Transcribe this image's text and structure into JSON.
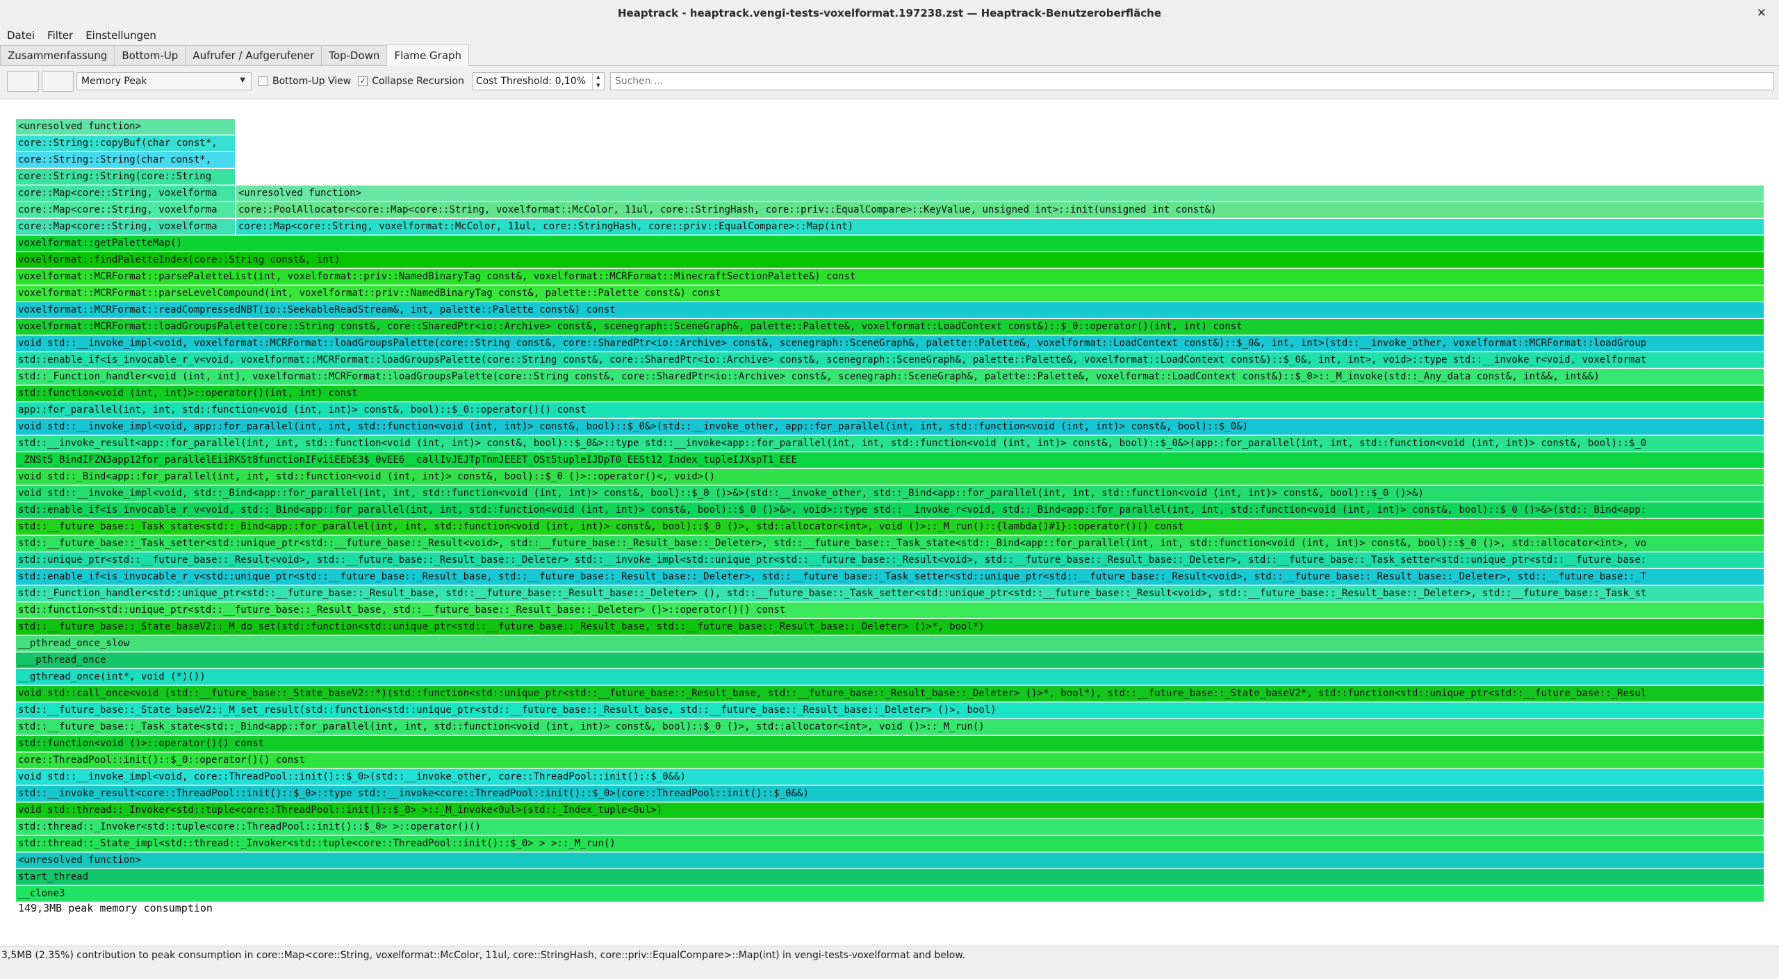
{
  "window": {
    "title": "Heaptrack - heaptrack.vengi-tests-voxelformat.197238.zst — Heaptrack-Benutzeroberfläche",
    "close_icon": "close-icon"
  },
  "menu": [
    "Datei",
    "Filter",
    "Einstellungen"
  ],
  "tabs": [
    "Zusammenfassung",
    "Bottom-Up",
    "Aufrufer / Aufgerufener",
    "Top-Down",
    "Flame Graph"
  ],
  "active_tab": 4,
  "toolbar": {
    "back_icon": "back-icon",
    "forward_icon": "forward-icon",
    "cost_type": "Memory Peak",
    "bottom_up_label": "Bottom-Up View",
    "bottom_up_checked": false,
    "collapse_label": "Collapse Recursion",
    "collapse_checked": true,
    "cost_threshold": "Cost Threshold: 0,10%",
    "search_placeholder": "Suchen ..."
  },
  "flamegraph": {
    "peak_label": "149,3MB peak memory consumption",
    "frames": [
      {
        "text": "<unresolved function>",
        "color": "#5fe3a6",
        "narrow": true
      },
      {
        "text": "core::String::copyBuf(char const*,",
        "color": "#35e0d2",
        "narrow": true
      },
      {
        "text": "core::String::String(char const*,",
        "color": "#47d9ee",
        "narrow": true
      },
      {
        "text": "core::String::String(core::String",
        "color": "#39e2a0",
        "narrow": true
      },
      {
        "text": "core::Map<core::String, voxelforma",
        "color": "#41e3a2",
        "right": "<unresolved function>",
        "right_color": "#6ae6a4"
      },
      {
        "text": "core::Map<core::String, voxelforma",
        "color": "#4ce8a2",
        "right": "core::PoolAllocator<core::Map<core::String, voxelformat::McColor, 11ul, core::StringHash, core::priv::EqualCompare>::KeyValue, unsigned int>::init(unsigned int const&)",
        "right_color": "#63e48c"
      },
      {
        "text": "core::Map<core::String, voxelforma",
        "color": "#3fe0b4",
        "right": "core::Map<core::String, voxelformat::McColor, 11ul, core::StringHash, core::priv::EqualCompare>::Map(int)",
        "right_color": "#27dfc8"
      },
      {
        "text": "voxelformat::getPaletteMap()",
        "color": "#0cd232"
      },
      {
        "text": "voxelformat::findPaletteIndex(core::String const&, int)",
        "color": "#06c400"
      },
      {
        "text": "voxelformat::MCRFormat::parsePaletteList(int, voxelformat::priv::NamedBinaryTag const&, voxelformat::MCRFormat::MinecraftSectionPalette&) const",
        "color": "#29e02a"
      },
      {
        "text": "voxelformat::MCRFormat::parseLevelCompound(int, voxelformat::priv::NamedBinaryTag const&, palette::Palette const&) const",
        "color": "#39e73c"
      },
      {
        "text": "voxelformat::MCRFormat::readCompressedNBT(io::SeekableReadStream&, int, palette::Palette const&) const",
        "color": "#16c8d0"
      },
      {
        "text": "voxelformat::MCRFormat::loadGroupsPalette(core::String const&, core::SharedPtr<io::Archive> const&, scenegraph::SceneGraph&, palette::Palette&, voxelformat::LoadContext const&)::$_0::operator()(int, int) const",
        "color": "#15d02e"
      },
      {
        "text": "void std::__invoke_impl<void, voxelformat::MCRFormat::loadGroupsPalette(core::String const&, core::SharedPtr<io::Archive> const&, scenegraph::SceneGraph&, palette::Palette&, voxelformat::LoadContext const&)::$_0&, int, int>(std::__invoke_other, voxelformat::MCRFormat::loadGroup",
        "color": "#18c7cf"
      },
      {
        "text": "std::enable_if<is_invocable_r_v<void, voxelformat::MCRFormat::loadGroupsPalette(core::String const&, core::SharedPtr<io::Archive> const&, scenegraph::SceneGraph&, palette::Palette&, voxelformat::LoadContext const&)::$_0&, int, int>, void>::type std::__invoke_r<void, voxelformat",
        "color": "#1fe0ac"
      },
      {
        "text": "std::_Function_handler<void (int, int), voxelformat::MCRFormat::loadGroupsPalette(core::String const&, core::SharedPtr<io::Archive> const&, scenegraph::SceneGraph&, palette::Palette&, voxelformat::LoadContext const&)::$_0>::_M_invoke(std::_Any_data const&, int&&, int&&)",
        "color": "#35e673"
      },
      {
        "text": "std::function<void (int, int)>::operator()(int, int) const",
        "color": "#10cc22"
      },
      {
        "text": "app::for_parallel(int, int, std::function<void (int, int)> const&, bool)::$_0::operator()() const",
        "color": "#1ae0b5"
      },
      {
        "text": "void std::__invoke_impl<void, app::for_parallel(int, int, std::function<void (int, int)> const&, bool)::$_0&>(std::__invoke_other, app::for_parallel(int, int, std::function<void (int, int)> const&, bool)::$_0&)",
        "color": "#15c6d2"
      },
      {
        "text": "std::__invoke_result<app::for_parallel(int, int, std::function<void (int, int)> const&, bool)::$_0&>::type std::__invoke<app::for_parallel(int, int, std::function<void (int, int)> const&, bool)::$_0&>(app::for_parallel(int, int, std::function<void (int, int)> const&, bool)::$_0",
        "color": "#2ae38f"
      },
      {
        "text": "_ZNSt5_BindIFZN3app12for_parallelEiiRKSt8functionIFviiEEbE3$_0vEE6__callIvJEJTpTnmJEEET_OSt5tupleIJDpT0_EESt12_Index_tupleIJXspT1_EEE",
        "color": "#0bd540"
      },
      {
        "text": "void std::_Bind<app::for_parallel(int, int, std::function<void (int, int)> const&, bool)::$_0 ()>::operator()<, void>()",
        "color": "#30e14a"
      },
      {
        "text": "void std::__invoke_impl<void, std::_Bind<app::for_parallel(int, int, std::function<void (int, int)> const&, bool)::$_0 ()>&>(std::__invoke_other, std::_Bind<app::for_parallel(int, int, std::function<void (int, int)> const&, bool)::$_0 ()>&)",
        "color": "#24dd6e"
      },
      {
        "text": "std::enable_if<is_invocable_r_v<void, std::_Bind<app::for_parallel(int, int, std::function<void (int, int)> const&, bool)::$_0 ()>&>, void>::type std::__invoke_r<void, std::_Bind<app::for_parallel(int, int, std::function<void (int, int)> const&, bool)::$_0 ()>&>(std::_Bind<app:",
        "color": "#10d55c"
      },
      {
        "text": "std::__future_base::_Task_state<std::_Bind<app::for_parallel(int, int, std::function<void (int, int)> const&, bool)::$_0 ()>, std::allocator<int>, void ()>::_M_run()::{lambda()#1}::operator()() const",
        "color": "#1fd21a"
      },
      {
        "text": "std::__future_base::_Task_setter<std::unique_ptr<std::__future_base::_Result<void>, std::__future_base::_Result_base::_Deleter>, std::__future_base::_Task_state<std::_Bind<app::for_parallel(int, int, std::function<void (int, int)> const&, bool)::$_0 ()>, std::allocator<int>, vo",
        "color": "#2ee160"
      },
      {
        "text": "std::unique_ptr<std::__future_base::_Result<void>, std::__future_base::_Result_base::_Deleter> std::__invoke_impl<std::unique_ptr<std::__future_base::_Result<void>, std::__future_base::_Result_base::_Deleter>, std::__future_base::_Task_setter<std::unique_ptr<std::__future_base:",
        "color": "#1cdca8"
      },
      {
        "text": "std::enable_if<is_invocable_r_v<std::unique_ptr<std::__future_base::_Result_base, std::__future_base::_Result_base::_Deleter>, std::__future_base::_Task_setter<std::unique_ptr<std::__future_base::_Result<void>, std::__future_base::_Result_base::_Deleter>, std::__future_base::_T",
        "color": "#17c9d2"
      },
      {
        "text": "std::_Function_handler<std::unique_ptr<std::__future_base::_Result_base, std::__future_base::_Result_base::_Deleter> (), std::__future_base::_Task_setter<std::unique_ptr<std::__future_base::_Result<void>, std::__future_base::_Result_base::_Deleter>, std::__future_base::_Task_st",
        "color": "#38e1b0"
      },
      {
        "text": "std::function<std::unique_ptr<std::__future_base::_Result_base, std::__future_base::_Result_base::_Deleter> ()>::operator()() const",
        "color": "#3ae85a"
      },
      {
        "text": "std::__future_base::_State_baseV2::_M_do_set(std::function<std::unique_ptr<std::__future_base::_Result_base, std::__future_base::_Result_base::_Deleter> ()>*, bool*)",
        "color": "#0ec40e"
      },
      {
        "text": "__pthread_once_slow",
        "color": "#45e07c"
      },
      {
        "text": "___pthread_once",
        "color": "#16c46a"
      },
      {
        "text": "__gthread_once(int*, void (*)())",
        "color": "#1cddc0"
      },
      {
        "text": "void std::call_once<void (std::__future_base::_State_baseV2::*)(std::function<std::unique_ptr<std::__future_base::_Result_base, std::__future_base::_Result_base::_Deleter> ()>*, bool*), std::__future_base::_State_baseV2*, std::function<std::unique_ptr<std::__future_base::_Resul",
        "color": "#14c520"
      },
      {
        "text": "std::__future_base::_State_baseV2::_M_set_result(std::function<std::unique_ptr<std::__future_base::_Result_base, std::__future_base::_Result_base::_Deleter> ()>, bool)",
        "color": "#1ae4c4"
      },
      {
        "text": "std::__future_base::_Task_state<std::_Bind<app::for_parallel(int, int, std::function<void (int, int)> const&, bool)::$_0 ()>, std::allocator<int>, void ()>::_M_run()",
        "color": "#35e56c"
      },
      {
        "text": "std::function<void ()>::operator()() const",
        "color": "#10cb2a"
      },
      {
        "text": "core::ThreadPool::init()::$_0::operator()() const",
        "color": "#2ee240"
      },
      {
        "text": "void std::__invoke_impl<void, core::ThreadPool::init()::$_0>(std::__invoke_other, core::ThreadPool::init()::$_0&&)",
        "color": "#22e0d4"
      },
      {
        "text": "std::__invoke_result<core::ThreadPool::init()::$_0>::type std::__invoke<core::ThreadPool::init()::$_0>(core::ThreadPool::init()::$_0&&)",
        "color": "#16c8cc"
      },
      {
        "text": "void std::thread::_Invoker<std::tuple<core::ThreadPool::init()::$_0> >::_M_invoke<0ul>(std::_Index_tuple<0ul>)",
        "color": "#0fc813"
      },
      {
        "text": "std::thread::_Invoker<std::tuple<core::ThreadPool::init()::$_0> >::operator()()",
        "color": "#33e66e"
      },
      {
        "text": "std::thread::_State_impl<std::thread::_Invoker<std::tuple<core::ThreadPool::init()::$_0> > >::_M_run()",
        "color": "#24e155"
      },
      {
        "text": "<unresolved function>",
        "color": "#14c8bf"
      },
      {
        "text": "start_thread",
        "color": "#12c66a"
      },
      {
        "text": "__clone3",
        "color": "#20e364"
      }
    ]
  },
  "status": "3,5MB (2.35%) contribution to peak consumption in core::Map<core::String, voxelformat::McColor, 11ul, core::StringHash, core::priv::EqualCompare>::Map(int) in vengi-tests-voxelformat and below."
}
